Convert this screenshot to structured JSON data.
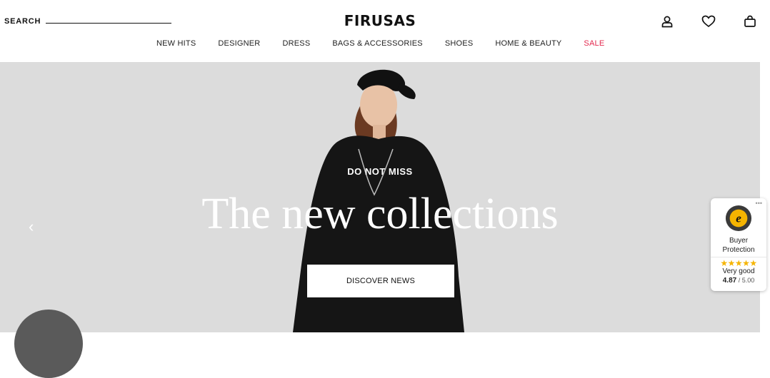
{
  "header": {
    "search_label": "SEARCH",
    "logo": "FIRUSAS",
    "icons": [
      "account-icon",
      "heart-icon",
      "bag-icon"
    ]
  },
  "nav": {
    "items": [
      {
        "label": "NEW HITS"
      },
      {
        "label": "DESIGNER"
      },
      {
        "label": "DRESS"
      },
      {
        "label": "BAGS & ACCESSORIES"
      },
      {
        "label": "SHOES"
      },
      {
        "label": "HOME & BEAUTY"
      },
      {
        "label": "SALE"
      }
    ],
    "sale_color": "#e3284e"
  },
  "hero": {
    "eyebrow": "DO NOT MISS",
    "headline": "The new collections",
    "cta": "DISCOVER NEWS",
    "prev_arrow": "‹",
    "background": "#dcdcdc"
  },
  "trust_badge": {
    "line1": "Buyer",
    "line2": "Protection",
    "stars": "★★★★★",
    "rating_text": "Very good",
    "score": "4.87",
    "score_max": " / 5.00"
  }
}
